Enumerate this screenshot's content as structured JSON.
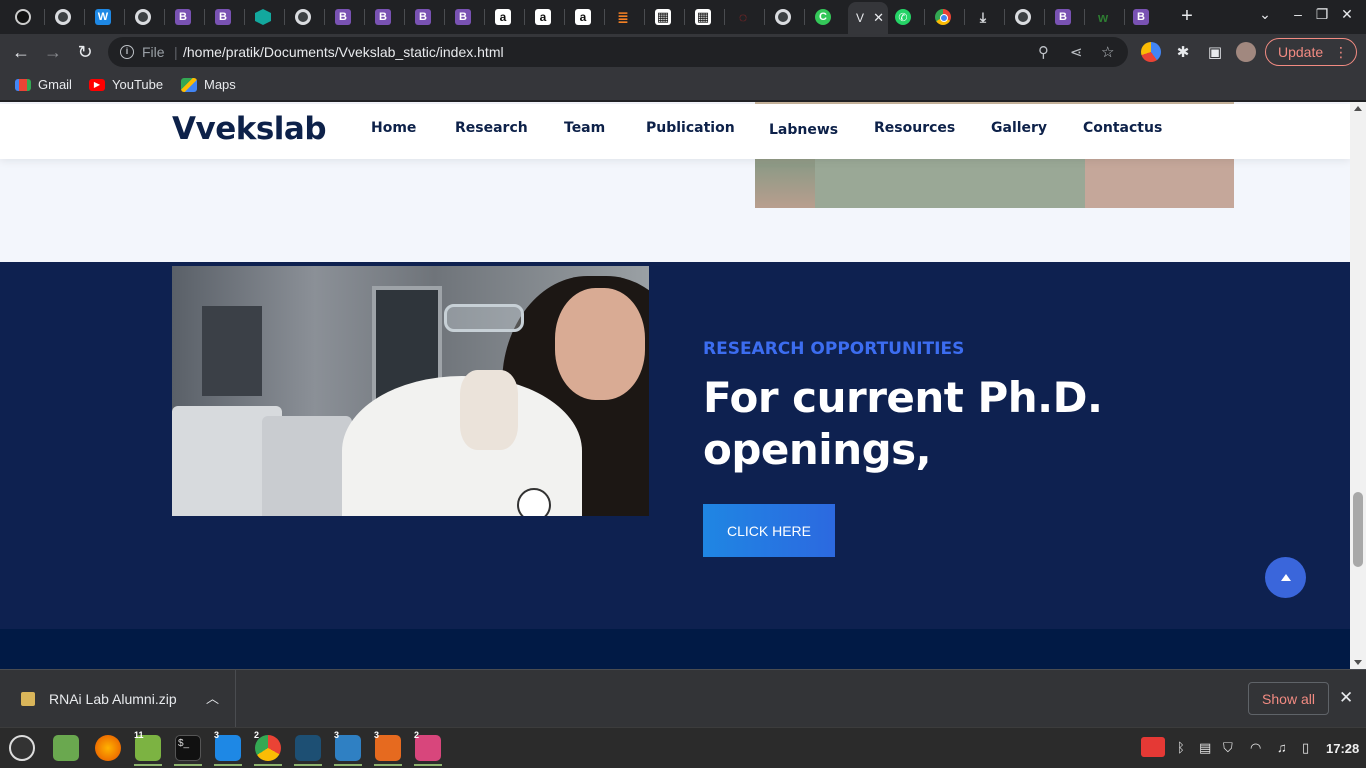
{
  "browser": {
    "tabs": [
      {
        "icon": "tor-icon"
      },
      {
        "icon": "globe-icon"
      },
      {
        "icon": "tooth-icon"
      },
      {
        "icon": "globe-icon"
      },
      {
        "icon": "bootstrap-icon",
        "glyph": "B"
      },
      {
        "icon": "bootstrap-icon",
        "glyph": "B"
      },
      {
        "icon": "hexagon-icon"
      },
      {
        "icon": "globe-icon"
      },
      {
        "icon": "bootstrap-icon",
        "glyph": "B"
      },
      {
        "icon": "bootstrap-icon",
        "glyph": "B"
      },
      {
        "icon": "bootstrap-icon",
        "glyph": "B"
      },
      {
        "icon": "bootstrap-icon",
        "glyph": "B"
      },
      {
        "icon": "amazon-icon",
        "glyph": "a"
      },
      {
        "icon": "amazon-icon",
        "glyph": "a"
      },
      {
        "icon": "amazon-icon",
        "glyph": "a"
      },
      {
        "icon": "stackoverflow-icon",
        "glyph": "≣"
      },
      {
        "icon": "checker-icon",
        "glyph": "▦"
      },
      {
        "icon": "checker-icon",
        "glyph": "▦"
      },
      {
        "icon": "red-logo-icon",
        "glyph": "◌"
      },
      {
        "icon": "globe-icon"
      },
      {
        "icon": "c-icon",
        "glyph": "C"
      }
    ],
    "active_tab": {
      "title": "V",
      "close_glyph": "✕"
    },
    "tabs_after": [
      {
        "icon": "whatsapp-icon",
        "glyph": "✆"
      },
      {
        "icon": "chrome-icon"
      },
      {
        "icon": "download-icon",
        "glyph": "⤓"
      },
      {
        "icon": "globe-icon"
      },
      {
        "icon": "bootstrap-icon",
        "glyph": "B"
      },
      {
        "icon": "w-icon",
        "glyph": "w"
      },
      {
        "icon": "bootstrap-icon",
        "glyph": "B"
      }
    ],
    "new_tab_glyph": "+",
    "toolbar": {
      "back": "←",
      "forward": "→",
      "reload": "↻",
      "scheme_label": "File",
      "url": "/home/pratik/Documents/Vvekslab_static/index.html",
      "update_label": "Update",
      "menu_glyph": "⋮"
    },
    "bookmarks": [
      {
        "label": "Gmail",
        "icon": "gmail-icon"
      },
      {
        "label": "YouTube",
        "icon": "youtube-icon"
      },
      {
        "label": "Maps",
        "icon": "maps-icon"
      }
    ]
  },
  "site": {
    "logo": "Vvekslab",
    "nav": [
      "Home",
      "Research",
      "Team",
      "Publication",
      "Labnews",
      "Resources",
      "Gallery",
      "Contactus"
    ],
    "opportunities": {
      "kicker": "RESEARCH OPPORTUNITIES",
      "heading": "For current Ph.D. openings,",
      "button": "CLICK HERE"
    }
  },
  "downloads": {
    "file_name": "RNAi Lab Alumni.zip",
    "show_all": "Show all",
    "close_glyph": "✕",
    "chevron": "︿"
  },
  "taskbar": {
    "badges": {
      "files": "11",
      "vscode": "3",
      "chrome": "2",
      "editor": "3",
      "vbox": "3",
      "photos": "2"
    },
    "clock": "17:28"
  }
}
